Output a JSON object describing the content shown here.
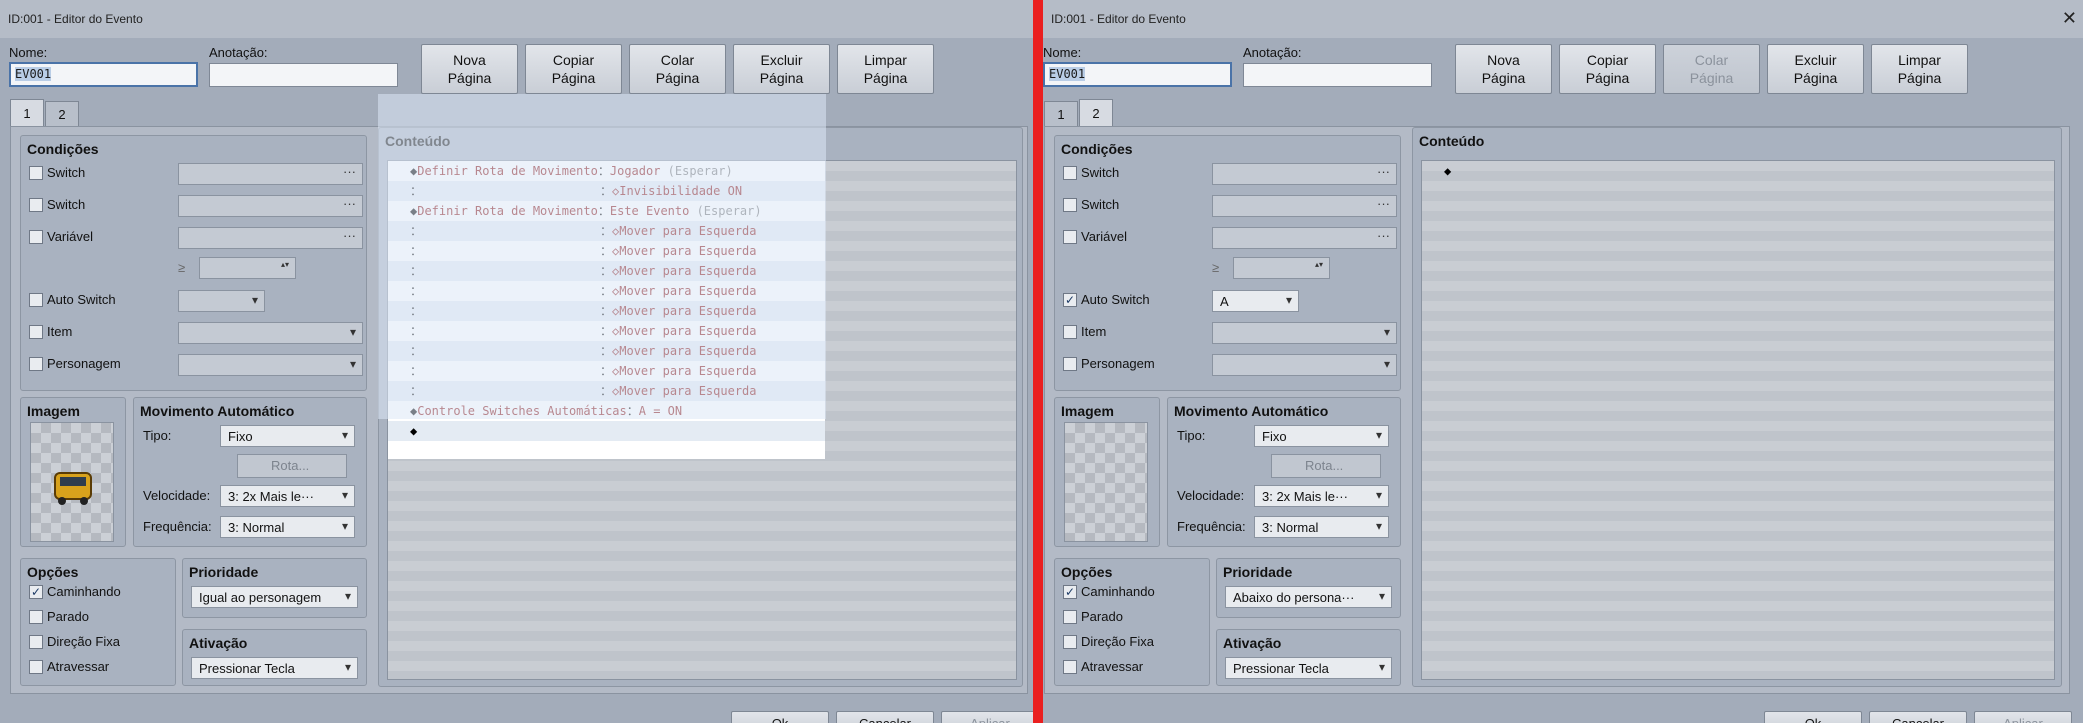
{
  "left": {
    "title": "ID:001 - Editor do Evento",
    "name_label": "Nome:",
    "name_value": "EV001",
    "note_label": "Anotação:",
    "buttons": [
      "Nova\nPágina",
      "Copiar\nPágina",
      "Colar\nPágina",
      "Excluir\nPágina",
      "Limpar\nPágina"
    ],
    "tabs": [
      "1",
      "2"
    ],
    "conditions": {
      "title": "Condições",
      "switch1": "Switch",
      "switch2": "Switch",
      "variable": "Variável",
      "gte": "≥",
      "auto_switch": "Auto Switch",
      "item": "Item",
      "character": "Personagem"
    },
    "image": {
      "title": "Imagem"
    },
    "movement": {
      "title": "Movimento Automático",
      "type_label": "Tipo:",
      "type_value": "Fixo",
      "route_button": "Rota...",
      "speed_label": "Velocidade:",
      "speed_value": "3: 2x Mais le···",
      "freq_label": "Frequência:",
      "freq_value": "3: Normal"
    },
    "options": {
      "title": "Opções",
      "walking": "Caminhando",
      "stopped": "Parado",
      "fixed_dir": "Direção Fixa",
      "through": "Atravessar"
    },
    "priority": {
      "title": "Prioridade",
      "value": "Igual ao personagem"
    },
    "trigger": {
      "title": "Ativação",
      "value": "Pressionar Tecla"
    },
    "content": {
      "title": "Conteúdo",
      "lines": [
        {
          "mark": "◆",
          "text": "Definir Rota de Movimento",
          "sep": "：",
          "arg": "Jogador",
          "extra": " (Esperar)"
        },
        {
          "mark": "",
          "text": "：",
          "sep": "：",
          "arg": "◇Invisibilidade ON",
          "extra": ""
        },
        {
          "mark": "◆",
          "text": "Definir Rota de Movimento",
          "sep": "：",
          "arg": "Este Evento",
          "extra": " (Esperar)"
        },
        {
          "mark": "",
          "text": "：",
          "sep": "：",
          "arg": "◇Mover para Esquerda",
          "extra": ""
        },
        {
          "mark": "",
          "text": "：",
          "sep": "：",
          "arg": "◇Mover para Esquerda",
          "extra": ""
        },
        {
          "mark": "",
          "text": "：",
          "sep": "：",
          "arg": "◇Mover para Esquerda",
          "extra": ""
        },
        {
          "mark": "",
          "text": "：",
          "sep": "：",
          "arg": "◇Mover para Esquerda",
          "extra": ""
        },
        {
          "mark": "",
          "text": "：",
          "sep": "：",
          "arg": "◇Mover para Esquerda",
          "extra": ""
        },
        {
          "mark": "",
          "text": "：",
          "sep": "：",
          "arg": "◇Mover para Esquerda",
          "extra": ""
        },
        {
          "mark": "",
          "text": "：",
          "sep": "：",
          "arg": "◇Mover para Esquerda",
          "extra": ""
        },
        {
          "mark": "",
          "text": "：",
          "sep": "：",
          "arg": "◇Mover para Esquerda",
          "extra": ""
        },
        {
          "mark": "",
          "text": "：",
          "sep": "：",
          "arg": "◇Mover para Esquerda",
          "extra": ""
        },
        {
          "mark": "◆",
          "text": "Controle Switches Automáticas",
          "sep": "：",
          "arg": "A = ON",
          "extra": ""
        },
        {
          "mark": "◆",
          "text": "",
          "sep": "",
          "arg": "",
          "extra": ""
        }
      ]
    },
    "bottom": [
      "Ok",
      "Cancelar",
      "Aplicar"
    ]
  },
  "right": {
    "title": "ID:001 - Editor do Evento",
    "close_icon": "✕",
    "name_label": "Nome:",
    "name_value": "EV001",
    "note_label": "Anotação:",
    "buttons": [
      "Nova\nPágina",
      "Copiar\nPágina",
      "Colar\nPágina",
      "Excluir\nPágina",
      "Limpar\nPágina"
    ],
    "tabs": [
      "1",
      "2"
    ],
    "conditions": {
      "title": "Condições",
      "switch1": "Switch",
      "switch2": "Switch",
      "variable": "Variável",
      "gte": "≥",
      "auto_switch": "Auto Switch",
      "auto_switch_value": "A",
      "item": "Item",
      "character": "Personagem"
    },
    "image": {
      "title": "Imagem"
    },
    "movement": {
      "title": "Movimento Automático",
      "type_label": "Tipo:",
      "type_value": "Fixo",
      "route_button": "Rota...",
      "speed_label": "Velocidade:",
      "speed_value": "3: 2x Mais le···",
      "freq_label": "Frequência:",
      "freq_value": "3: Normal"
    },
    "options": {
      "title": "Opções",
      "walking": "Caminhando",
      "stopped": "Parado",
      "fixed_dir": "Direção Fixa",
      "through": "Atravessar"
    },
    "priority": {
      "title": "Prioridade",
      "value": "Abaixo do persona···"
    },
    "trigger": {
      "title": "Ativação",
      "value": "Pressionar Tecla"
    },
    "content": {
      "title": "Conteúdo",
      "marker": "◆"
    },
    "bottom": [
      "Ok",
      "Cancelar",
      "Aplicar"
    ]
  },
  "icons": {
    "dots": "···",
    "arrow": "▾",
    "check": "✓",
    "spin": "▴▾"
  }
}
